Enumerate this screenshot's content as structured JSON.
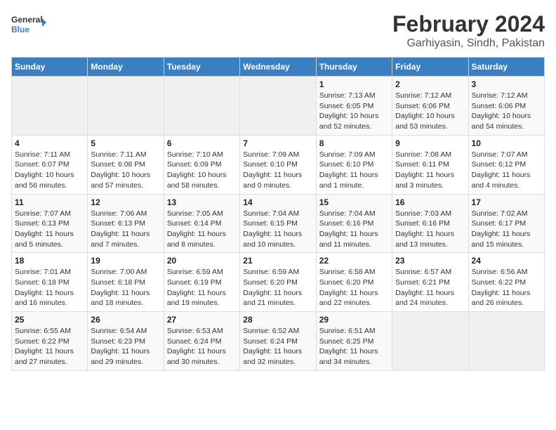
{
  "logo": {
    "line1": "General",
    "line2": "Blue"
  },
  "title": "February 2024",
  "subtitle": "Garhiyasin, Sindh, Pakistan",
  "days_header": [
    "Sunday",
    "Monday",
    "Tuesday",
    "Wednesday",
    "Thursday",
    "Friday",
    "Saturday"
  ],
  "weeks": [
    [
      {
        "num": "",
        "info": ""
      },
      {
        "num": "",
        "info": ""
      },
      {
        "num": "",
        "info": ""
      },
      {
        "num": "",
        "info": ""
      },
      {
        "num": "1",
        "info": "Sunrise: 7:13 AM\nSunset: 6:05 PM\nDaylight: 10 hours\nand 52 minutes."
      },
      {
        "num": "2",
        "info": "Sunrise: 7:12 AM\nSunset: 6:06 PM\nDaylight: 10 hours\nand 53 minutes."
      },
      {
        "num": "3",
        "info": "Sunrise: 7:12 AM\nSunset: 6:06 PM\nDaylight: 10 hours\nand 54 minutes."
      }
    ],
    [
      {
        "num": "4",
        "info": "Sunrise: 7:11 AM\nSunset: 6:07 PM\nDaylight: 10 hours\nand 56 minutes."
      },
      {
        "num": "5",
        "info": "Sunrise: 7:11 AM\nSunset: 6:08 PM\nDaylight: 10 hours\nand 57 minutes."
      },
      {
        "num": "6",
        "info": "Sunrise: 7:10 AM\nSunset: 6:09 PM\nDaylight: 10 hours\nand 58 minutes."
      },
      {
        "num": "7",
        "info": "Sunrise: 7:09 AM\nSunset: 6:10 PM\nDaylight: 11 hours\nand 0 minutes."
      },
      {
        "num": "8",
        "info": "Sunrise: 7:09 AM\nSunset: 6:10 PM\nDaylight: 11 hours\nand 1 minute."
      },
      {
        "num": "9",
        "info": "Sunrise: 7:08 AM\nSunset: 6:11 PM\nDaylight: 11 hours\nand 3 minutes."
      },
      {
        "num": "10",
        "info": "Sunrise: 7:07 AM\nSunset: 6:12 PM\nDaylight: 11 hours\nand 4 minutes."
      }
    ],
    [
      {
        "num": "11",
        "info": "Sunrise: 7:07 AM\nSunset: 6:13 PM\nDaylight: 11 hours\nand 5 minutes."
      },
      {
        "num": "12",
        "info": "Sunrise: 7:06 AM\nSunset: 6:13 PM\nDaylight: 11 hours\nand 7 minutes."
      },
      {
        "num": "13",
        "info": "Sunrise: 7:05 AM\nSunset: 6:14 PM\nDaylight: 11 hours\nand 8 minutes."
      },
      {
        "num": "14",
        "info": "Sunrise: 7:04 AM\nSunset: 6:15 PM\nDaylight: 11 hours\nand 10 minutes."
      },
      {
        "num": "15",
        "info": "Sunrise: 7:04 AM\nSunset: 6:16 PM\nDaylight: 11 hours\nand 11 minutes."
      },
      {
        "num": "16",
        "info": "Sunrise: 7:03 AM\nSunset: 6:16 PM\nDaylight: 11 hours\nand 13 minutes."
      },
      {
        "num": "17",
        "info": "Sunrise: 7:02 AM\nSunset: 6:17 PM\nDaylight: 11 hours\nand 15 minutes."
      }
    ],
    [
      {
        "num": "18",
        "info": "Sunrise: 7:01 AM\nSunset: 6:18 PM\nDaylight: 11 hours\nand 16 minutes."
      },
      {
        "num": "19",
        "info": "Sunrise: 7:00 AM\nSunset: 6:18 PM\nDaylight: 11 hours\nand 18 minutes."
      },
      {
        "num": "20",
        "info": "Sunrise: 6:59 AM\nSunset: 6:19 PM\nDaylight: 11 hours\nand 19 minutes."
      },
      {
        "num": "21",
        "info": "Sunrise: 6:59 AM\nSunset: 6:20 PM\nDaylight: 11 hours\nand 21 minutes."
      },
      {
        "num": "22",
        "info": "Sunrise: 6:58 AM\nSunset: 6:20 PM\nDaylight: 11 hours\nand 22 minutes."
      },
      {
        "num": "23",
        "info": "Sunrise: 6:57 AM\nSunset: 6:21 PM\nDaylight: 11 hours\nand 24 minutes."
      },
      {
        "num": "24",
        "info": "Sunrise: 6:56 AM\nSunset: 6:22 PM\nDaylight: 11 hours\nand 26 minutes."
      }
    ],
    [
      {
        "num": "25",
        "info": "Sunrise: 6:55 AM\nSunset: 6:22 PM\nDaylight: 11 hours\nand 27 minutes."
      },
      {
        "num": "26",
        "info": "Sunrise: 6:54 AM\nSunset: 6:23 PM\nDaylight: 11 hours\nand 29 minutes."
      },
      {
        "num": "27",
        "info": "Sunrise: 6:53 AM\nSunset: 6:24 PM\nDaylight: 11 hours\nand 30 minutes."
      },
      {
        "num": "28",
        "info": "Sunrise: 6:52 AM\nSunset: 6:24 PM\nDaylight: 11 hours\nand 32 minutes."
      },
      {
        "num": "29",
        "info": "Sunrise: 6:51 AM\nSunset: 6:25 PM\nDaylight: 11 hours\nand 34 minutes."
      },
      {
        "num": "",
        "info": ""
      },
      {
        "num": "",
        "info": ""
      }
    ]
  ]
}
